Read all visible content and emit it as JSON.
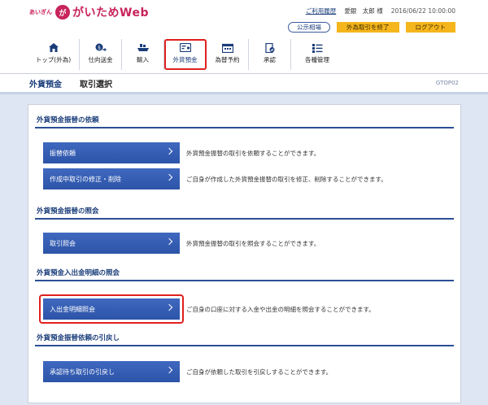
{
  "header": {
    "logo_small": "あいぎん",
    "logo_mark": "が",
    "logo_text": "がいためWeb",
    "links": {
      "history": "ご利用履歴",
      "user": "愛銀　太郎 様",
      "datetime": "2016/06/22 10:00:00"
    },
    "buttons": {
      "rates": "公示相場",
      "end_fx": "外為取引を終了",
      "logout": "ログアウト"
    }
  },
  "nav": [
    {
      "label": "トップ(外為)",
      "icon": "home-icon"
    },
    {
      "label": "仕向送金",
      "icon": "remittance-icon"
    },
    {
      "label": "輸入",
      "icon": "import-ship-icon"
    },
    {
      "label": "外貨預金",
      "icon": "deposit-icon"
    },
    {
      "label": "為替予約",
      "icon": "exchange-booking-icon"
    },
    {
      "label": "承認",
      "icon": "approval-icon"
    },
    {
      "label": "各種管理",
      "icon": "management-icon"
    }
  ],
  "titlebar": {
    "main": "外貨預金",
    "sub": "取引選択",
    "code": "GTOP02"
  },
  "sections": [
    {
      "title": "外貨預金振替の依頼",
      "items": [
        {
          "label": "振替依頼",
          "desc": "外貨預金振替の取引を依頼することができます。"
        },
        {
          "label": "作成中取引の修正・削除",
          "desc": "ご自身が作成した外貨預金振替の取引を修正、削除することができます。"
        }
      ]
    },
    {
      "title": "外貨預金振替の照会",
      "items": [
        {
          "label": "取引照会",
          "desc": "外貨預金振替の取引を照会することができます。"
        }
      ]
    },
    {
      "title": "外貨預金入出金明細の照会",
      "items": [
        {
          "label": "入出金明細照会",
          "desc": "ご自身の口座に対する入金や出金の明細を照会することができます。"
        }
      ]
    },
    {
      "title": "外貨預金振替依頼の引戻し",
      "items": [
        {
          "label": "承認待ち取引の引戻し",
          "desc": "ご自身が依頼した取引を引戻しすることができます。"
        }
      ]
    }
  ],
  "colors": {
    "brand": "#c8235a",
    "accent": "#2c54a8",
    "highlight": "#e02020",
    "button_yellow": "#f5b51c"
  }
}
